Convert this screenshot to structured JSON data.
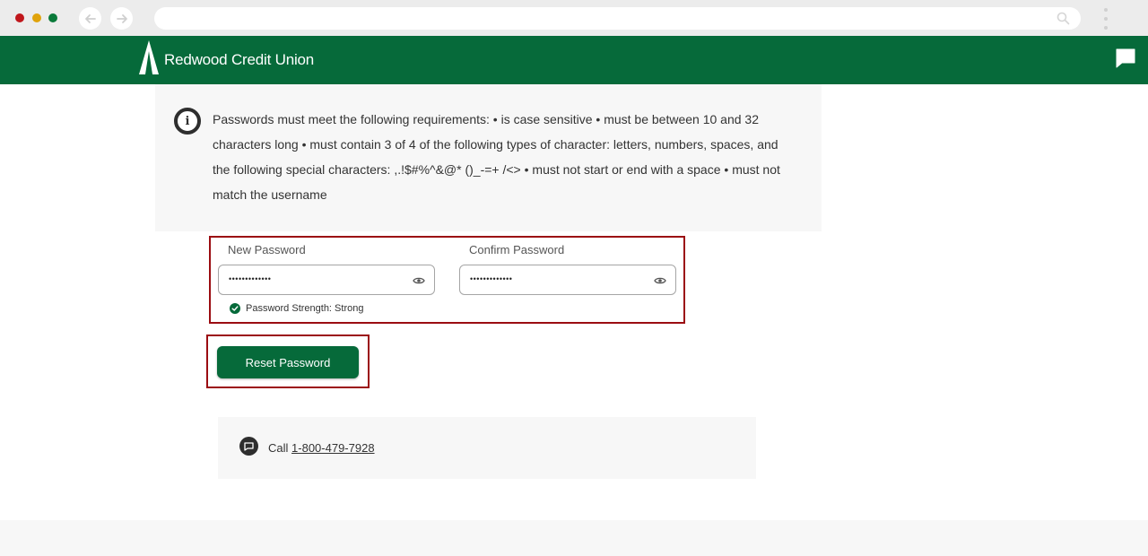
{
  "header": {
    "brand_name": "Redwood Credit Union",
    "brand_color": "#066a3a"
  },
  "info": {
    "icon": "info-icon",
    "requirements_text": "Passwords must meet the following requirements: • is case sensitive • must be between 10 and 32 characters long • must contain 3 of 4 of the following types of character: letters, numbers, spaces, and the following special characters: ,.!$#%^&@* ()_-=+ /<> • must not start or end with a space • must not match the username"
  },
  "form": {
    "new_password_label": "New Password",
    "new_password_value": "•••••••••••••",
    "confirm_password_label": "Confirm Password",
    "confirm_password_value": "•••••••••••••",
    "strength_text": "Password Strength: Strong",
    "reset_button_label": "Reset Password",
    "highlight_color": "#9b0d12"
  },
  "call": {
    "prefix": "Call",
    "phone": "1-800-479-7928"
  }
}
